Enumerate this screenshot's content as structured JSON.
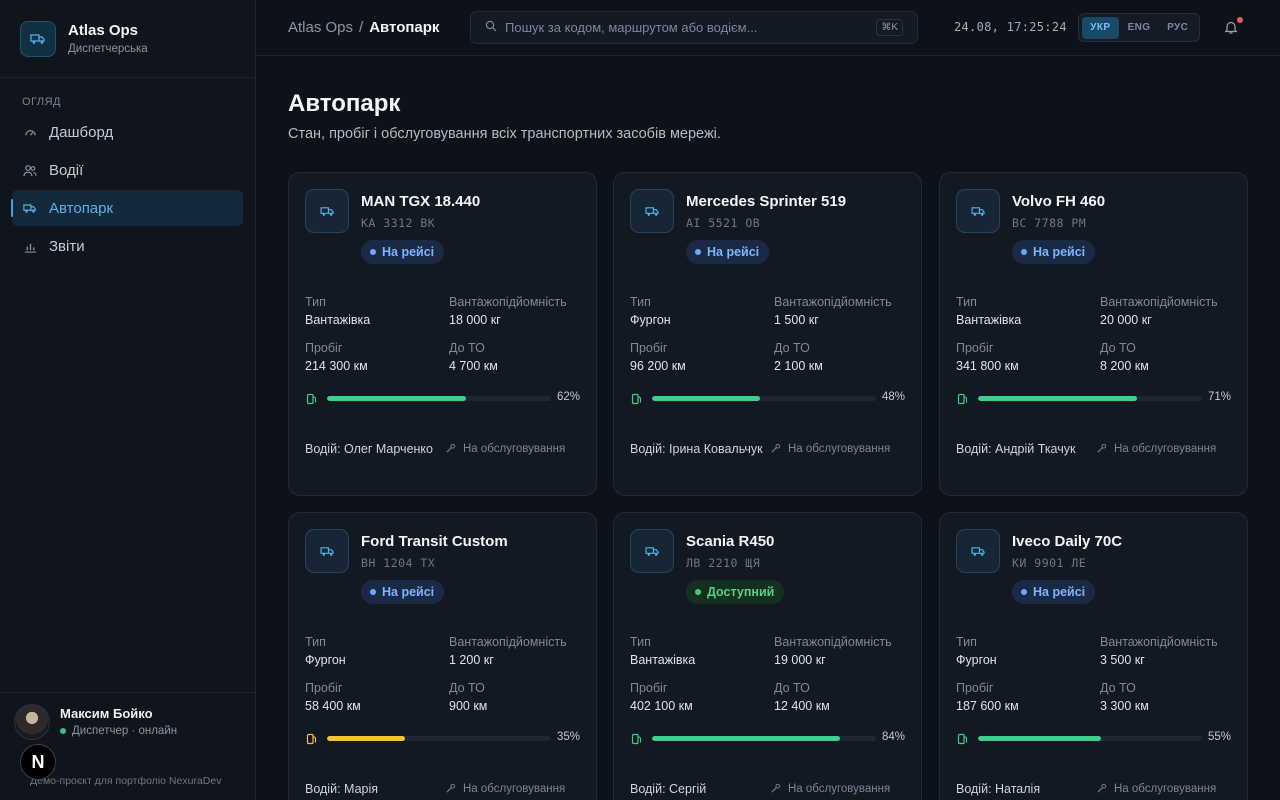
{
  "app": {
    "name": "Atlas Ops",
    "subtitle": "Диспетчерська"
  },
  "sidebar": {
    "section_label": "ОГЛЯД",
    "items": [
      {
        "label": "Дашборд",
        "icon": "gauge-icon",
        "active": false
      },
      {
        "label": "Водії",
        "icon": "users-icon",
        "active": false
      },
      {
        "label": "Автопарк",
        "icon": "truck-icon",
        "active": true
      },
      {
        "label": "Звіти",
        "icon": "bar-chart-icon",
        "active": false
      }
    ],
    "user": {
      "name": "Максим Бойко",
      "status": "Диспетчер · онлайн"
    },
    "footer": "Демо-проєкт для портфоліо NexuraDev",
    "next_badge": "N"
  },
  "topbar": {
    "breadcrumb_root": "Atlas Ops",
    "breadcrumb_sep": "/",
    "breadcrumb_current": "Автопарк",
    "search_placeholder": "Пошук за кодом, маршрутом або водієм...",
    "search_shortcut": "⌘K",
    "datetime": "24.08, 17:25:24",
    "languages": [
      {
        "label": "УКР",
        "active": true
      },
      {
        "label": "ENG",
        "active": false
      },
      {
        "label": "РУС",
        "active": false
      }
    ]
  },
  "page": {
    "title": "Автопарк",
    "subtitle": "Стан, пробіг і обслуговування всіх транспортних засобів мережі."
  },
  "labels": {
    "type": "Тип",
    "capacity": "Вантажопідйомність",
    "mileage": "Пробіг",
    "to_service": "До ТО",
    "service_action": "На обслуговування"
  },
  "colors": {
    "accent": "#3ba7e6",
    "fuel_ok": "#3ecf8e",
    "fuel_low": "#f2c23d",
    "trip": "#7eb4ff",
    "available": "#55d08c"
  },
  "vehicles": [
    {
      "name": "MAN TGX 18.440",
      "plate": "KA 3312 BK",
      "status": "На рейсі",
      "status_kind": "trip",
      "type": "Вантажівка",
      "capacity": "18 000 кг",
      "mileage": "214 300 км",
      "to_service": "4 700 км",
      "fuel": 62,
      "fuel_pct": "62%",
      "fuel_state": "ok",
      "driver": "Водій: Олег Марченко"
    },
    {
      "name": "Mercedes Sprinter 519",
      "plate": "AI 5521 OB",
      "status": "На рейсі",
      "status_kind": "trip",
      "type": "Фургон",
      "capacity": "1 500 кг",
      "mileage": "96 200 км",
      "to_service": "2 100 км",
      "fuel": 48,
      "fuel_pct": "48%",
      "fuel_state": "ok",
      "driver": "Водій: Ірина Ковальчук"
    },
    {
      "name": "Volvo FH 460",
      "plate": "BC 7788 PM",
      "status": "На рейсі",
      "status_kind": "trip",
      "type": "Вантажівка",
      "capacity": "20 000 кг",
      "mileage": "341 800 км",
      "to_service": "8 200 км",
      "fuel": 71,
      "fuel_pct": "71%",
      "fuel_state": "ok",
      "driver": "Водій: Андрій Ткачук"
    },
    {
      "name": "Ford Transit Custom",
      "plate": "BH 1204 TX",
      "status": "На рейсі",
      "status_kind": "trip",
      "type": "Фургон",
      "capacity": "1 200 кг",
      "mileage": "58 400 км",
      "to_service": "900 км",
      "fuel": 35,
      "fuel_pct": "35%",
      "fuel_state": "low",
      "driver": "Водій: Марія"
    },
    {
      "name": "Scania R450",
      "plate": "ЛВ 2210 ЩЯ",
      "status": "Доступний",
      "status_kind": "free",
      "type": "Вантажівка",
      "capacity": "19 000 кг",
      "mileage": "402 100 км",
      "to_service": "12 400 км",
      "fuel": 84,
      "fuel_pct": "84%",
      "fuel_state": "ok",
      "driver": "Водій: Сергій"
    },
    {
      "name": "Iveco Daily 70C",
      "plate": "КИ 9901 ЛЕ",
      "status": "На рейсі",
      "status_kind": "trip",
      "type": "Фургон",
      "capacity": "3 500 кг",
      "mileage": "187 600 км",
      "to_service": "3 300 км",
      "fuel": 55,
      "fuel_pct": "55%",
      "fuel_state": "ok",
      "driver": "Водій: Наталія"
    }
  ]
}
